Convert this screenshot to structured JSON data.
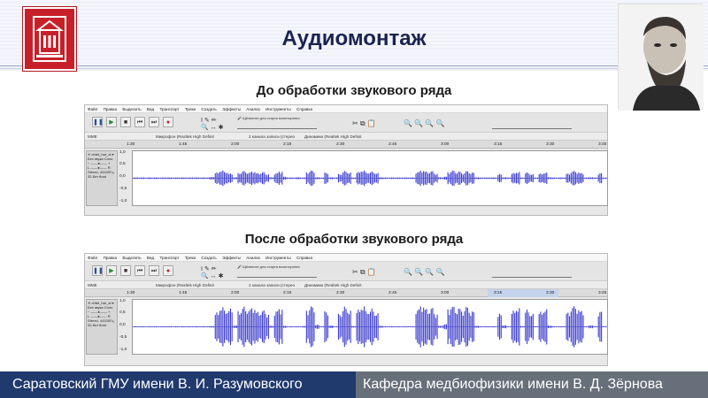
{
  "slide": {
    "title": "Аудиомонтаж",
    "before_title": "До обработки звукового ряда",
    "after_title": "После обработки звукового ряда"
  },
  "audacity": {
    "menu": [
      "Файл",
      "Правка",
      "Выделить",
      "Вид",
      "Транспорт",
      "Треки",
      "Создать",
      "Эффекты",
      "Анализ",
      "Инструменты",
      "Справка"
    ],
    "monitor_hint": "Щёлкните для старта мониторинга",
    "host": "MME",
    "mic": "Микрофон (Realtek High Definit",
    "channels": "2 канала записи (стерео",
    "speakers": "Динамики (Realtek High Definit",
    "ruler_ticks": [
      "1:30",
      "1:45",
      "2:00",
      "2:15",
      "2:30",
      "2:45",
      "3:00",
      "3:15",
      "3:30",
      "3:45"
    ],
    "track_name": "chtet_har_al",
    "track_mute": "Без звука",
    "track_solo": "Соло",
    "track_info": "Stereo, 44100Гц",
    "track_format": "32-бит float",
    "scale_labels": [
      "1,0",
      "0,5",
      "0,0",
      "-0,5",
      "-1,0"
    ],
    "before_env": [
      0.03,
      0.03,
      0.03,
      0.03,
      0.03,
      0.03,
      0.03,
      0.03,
      0.03,
      0.03,
      0.03,
      0.03,
      0.03,
      0.03,
      0.03,
      0.03,
      0.03,
      0.05,
      0.22,
      0.3,
      0.24,
      0.18,
      0.04,
      0.2,
      0.28,
      0.22,
      0.26,
      0.2,
      0.24,
      0.16,
      0.04,
      0.2,
      0.26,
      0.06,
      0.03,
      0.03,
      0.04,
      0.03,
      0.24,
      0.3,
      0.04,
      0.03,
      0.22,
      0.04,
      0.03,
      0.16,
      0.28,
      0.22,
      0.03,
      0.24,
      0.3,
      0.22,
      0.26,
      0.2,
      0.04,
      0.03,
      0.03,
      0.03,
      0.03,
      0.03,
      0.03,
      0.03,
      0.24,
      0.3,
      0.26,
      0.28,
      0.18,
      0.04,
      0.06,
      0.24,
      0.3,
      0.26,
      0.2,
      0.28,
      0.22,
      0.04,
      0.03,
      0.03,
      0.03,
      0.03,
      0.16,
      0.04,
      0.03,
      0.2,
      0.24,
      0.03,
      0.22,
      0.16,
      0.03,
      0.18,
      0.22,
      0.04,
      0.03,
      0.03,
      0.03,
      0.18,
      0.28,
      0.24,
      0.2,
      0.03,
      0.04,
      0.03,
      0.2,
      0.03
    ],
    "after_env": [
      0.02,
      0.02,
      0.02,
      0.02,
      0.02,
      0.02,
      0.02,
      0.02,
      0.02,
      0.02,
      0.02,
      0.02,
      0.02,
      0.02,
      0.02,
      0.02,
      0.02,
      0.03,
      0.55,
      0.75,
      0.62,
      0.7,
      0.05,
      0.6,
      0.78,
      0.66,
      0.72,
      0.58,
      0.64,
      0.5,
      0.04,
      0.62,
      0.7,
      0.04,
      0.02,
      0.02,
      0.02,
      0.03,
      0.66,
      0.8,
      0.08,
      0.02,
      0.6,
      0.05,
      0.02,
      0.5,
      0.78,
      0.62,
      0.03,
      0.66,
      0.78,
      0.6,
      0.7,
      0.52,
      0.04,
      0.02,
      0.02,
      0.02,
      0.02,
      0.02,
      0.02,
      0.02,
      0.68,
      0.8,
      0.7,
      0.74,
      0.5,
      0.04,
      0.1,
      0.7,
      0.8,
      0.72,
      0.62,
      0.78,
      0.6,
      0.04,
      0.02,
      0.02,
      0.02,
      0.02,
      0.5,
      0.06,
      0.02,
      0.62,
      0.72,
      0.03,
      0.66,
      0.5,
      0.02,
      0.58,
      0.68,
      0.05,
      0.02,
      0.02,
      0.02,
      0.55,
      0.8,
      0.7,
      0.62,
      0.02,
      0.06,
      0.02,
      0.6,
      0.02
    ],
    "wave_color": "#3c3ccf"
  },
  "footer": {
    "left": "Саратовский ГМУ имени В. И. Разумовского",
    "right": "Кафедра медбиофизики имени В. Д. Зёрнова",
    "left_color": "#203a6e",
    "right_color": "#676f7a"
  }
}
